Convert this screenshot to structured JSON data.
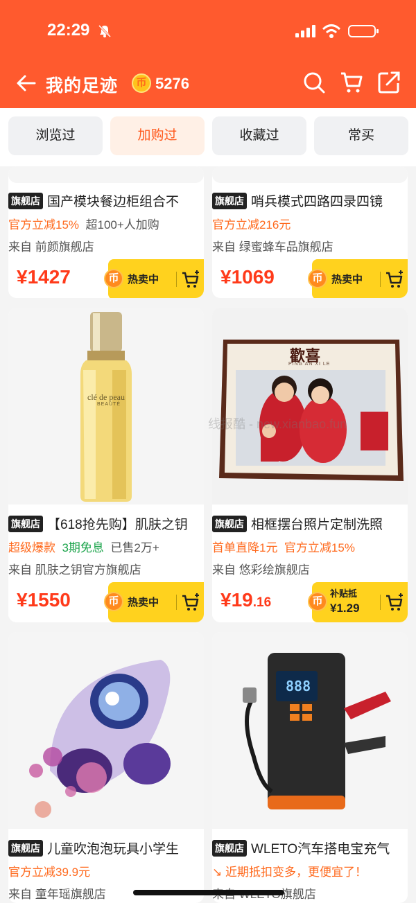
{
  "status_bar": {
    "time": "22:29"
  },
  "header": {
    "title": "我的足迹",
    "coin_glyph": "币",
    "coin_count": "5276"
  },
  "tabs": [
    {
      "label": "浏览过",
      "active": false
    },
    {
      "label": "加购过",
      "active": true
    },
    {
      "label": "收藏过",
      "active": false
    },
    {
      "label": "常买",
      "active": false
    }
  ],
  "products": [
    {
      "badge": "旗舰店",
      "name": "国产模块餐边柜组合不",
      "promos": [
        {
          "text": "官方立减15%",
          "color": "orange"
        },
        {
          "text": "超100+人加购",
          "color": "gray"
        }
      ],
      "from": "来自 前颜旗舰店",
      "price": "¥1427",
      "cta_type": "hot",
      "cta_label": "热卖中"
    },
    {
      "badge": "旗舰店",
      "name": "哨兵模式四路四录四镜",
      "promos": [
        {
          "text": "官方立减216元",
          "color": "orange"
        }
      ],
      "from": "来自 绿蜜蜂车品旗舰店",
      "price": "¥1069",
      "cta_type": "hot",
      "cta_label": "热卖中"
    },
    {
      "badge": "旗舰店",
      "name": "【618抢先购】肌肤之钥",
      "promos": [
        {
          "text": "超级爆款",
          "color": "orange"
        },
        {
          "text": "3期免息",
          "color": "green"
        },
        {
          "text": "已售2万+",
          "color": "gray"
        }
      ],
      "from": "来自 肌肤之钥官方旗舰店",
      "price": "¥1550",
      "cta_type": "hot",
      "cta_label": "热卖中",
      "image_text": {
        "brand": "clé de peau",
        "sub": "BEAUTÉ"
      }
    },
    {
      "badge": "旗舰店",
      "name": "相框摆台照片定制洗照",
      "promos": [
        {
          "text": "首单直降1元",
          "color": "orange"
        },
        {
          "text": "官方立减15%",
          "color": "orange"
        }
      ],
      "from": "来自 悠彩绘旗舰店",
      "price_main": "¥19",
      "price_dec": ".16",
      "cta_type": "subsidy",
      "cta_label": "补贴抵",
      "cta_value": "¥1.29",
      "image_text": {
        "title": "歡喜",
        "sub": "PING  AN  XI  LE"
      }
    },
    {
      "badge": "旗舰店",
      "name": "儿童吹泡泡玩具小学生",
      "promos": [
        {
          "text": "官方立减39.9元",
          "color": "orange"
        }
      ],
      "from": "来自 童年瑶旗舰店"
    },
    {
      "badge": "旗舰店",
      "name": "WLETO汽车搭电宝充气",
      "promos": [
        {
          "text": "↘ 近期抵扣变多，更便宜了！",
          "color": "orange"
        }
      ],
      "from": "来自 WLETO旗舰店",
      "image_text": {
        "display": "888"
      }
    }
  ],
  "cta_coin_glyph": "币",
  "watermark": "线报酷 - new.xianbao.fun",
  "icons": [
    "back-arrow-icon",
    "coin-icon",
    "search-icon",
    "cart-icon",
    "share-icon",
    "add-to-cart-icon",
    "bell-mute-icon",
    "signal-icon",
    "wifi-icon",
    "battery-icon"
  ]
}
